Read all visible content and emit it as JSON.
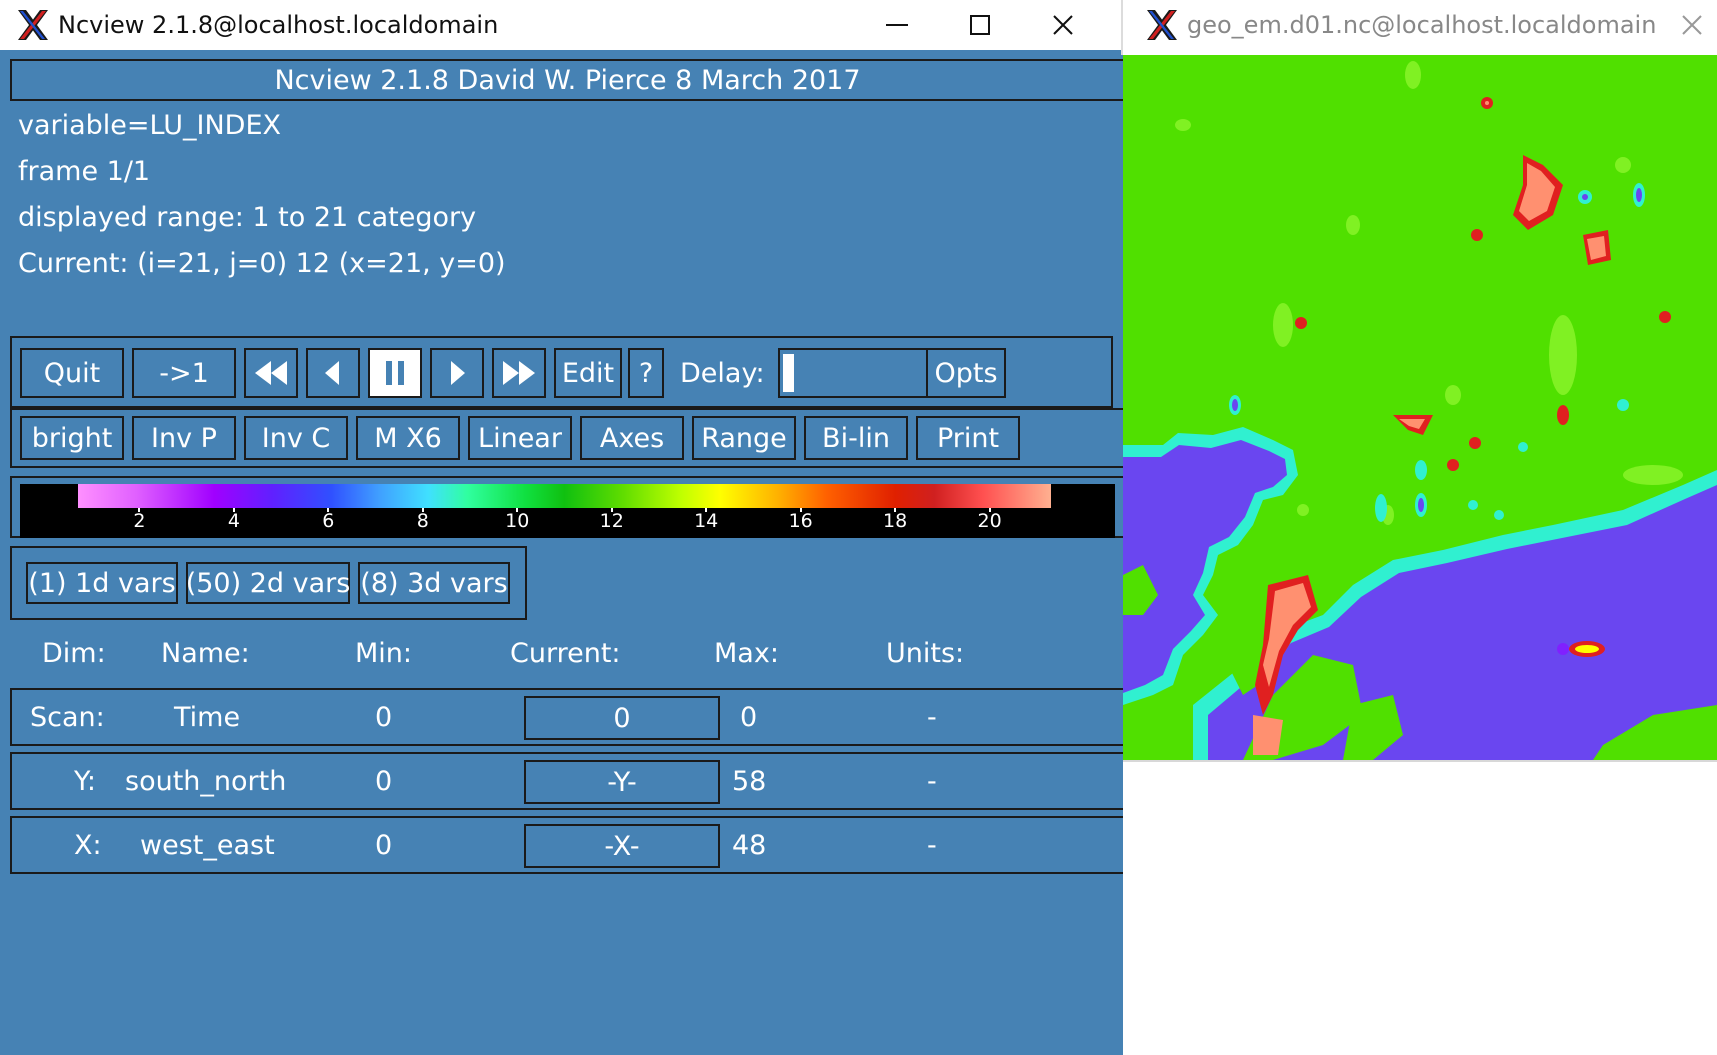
{
  "main_window": {
    "title": "Ncview 2.1.8@localhost.localdomain",
    "banner": "Ncview 2.1.8 David W. Pierce  8 March 2017",
    "variable_line": "variable=LU_INDEX",
    "frame_line": "frame 1/1",
    "range_line": "displayed range: 1 to 21 category",
    "current_line": "Current: (i=21, j=0) 12 (x=21, y=0)",
    "controls": {
      "quit": "Quit",
      "reset": "->1",
      "delay_label": "Delay:",
      "edit": "Edit",
      "help": "?",
      "opts": "Opts",
      "delay_value": 0
    },
    "options": [
      "bright",
      "Inv P",
      "Inv C",
      "M X6",
      "Linear",
      "Axes",
      "Range",
      "Bi-lin",
      "Print"
    ],
    "colorbar": {
      "ticks": [
        "2",
        "4",
        "6",
        "8",
        "10",
        "12",
        "14",
        "16",
        "18",
        "20"
      ]
    },
    "var_groups": [
      "(1) 1d vars",
      "(50) 2d vars",
      "(8) 3d vars"
    ],
    "dim_headers": {
      "dim": "Dim:",
      "name": "Name:",
      "min": "Min:",
      "current": "Current:",
      "max": "Max:",
      "units": "Units:"
    },
    "dims": [
      {
        "dim": "Scan:",
        "name": "Time",
        "min": "0",
        "current": "0",
        "max": "0",
        "units": "-"
      },
      {
        "dim": "Y:",
        "name": "south_north",
        "min": "0",
        "current": "-Y-",
        "max": "58",
        "units": "-"
      },
      {
        "dim": "X:",
        "name": "west_east",
        "min": "0",
        "current": "-X-",
        "max": "48",
        "units": "-"
      }
    ]
  },
  "image_window": {
    "title": "geo_em.d01.nc@localhost.localdomain"
  },
  "colors": {
    "panel_bg": "#4682b4",
    "map_land": "#50e000",
    "map_water": "#6a46f0",
    "map_edge_inner": "#30f0d0",
    "map_urban": "#ff9070"
  }
}
